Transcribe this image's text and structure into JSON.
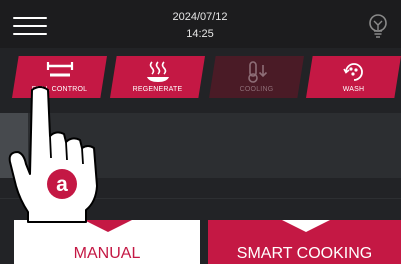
{
  "header": {
    "date": "2024/07/12",
    "time": "14:25",
    "menu_icon": "hamburger-menu-icon",
    "light_icon": "lightbulb-icon"
  },
  "modes": [
    {
      "label": "FULL CONTROL",
      "icon": "pan-icon",
      "active": true
    },
    {
      "label": "REGENERATE",
      "icon": "steam-plate-icon",
      "active": true
    },
    {
      "label": "COOLING",
      "icon": "thermometer-down-icon",
      "active": false
    },
    {
      "label": "WASH",
      "icon": "wash-cycle-icon",
      "active": true
    }
  ],
  "bottom": {
    "manual_label": "MANUAL",
    "smart_label": "SMART COOKING"
  },
  "annotation": {
    "badge_letter": "a"
  },
  "colors": {
    "accent": "#c41844",
    "background": "#222326",
    "header": "#1c1c1e"
  }
}
